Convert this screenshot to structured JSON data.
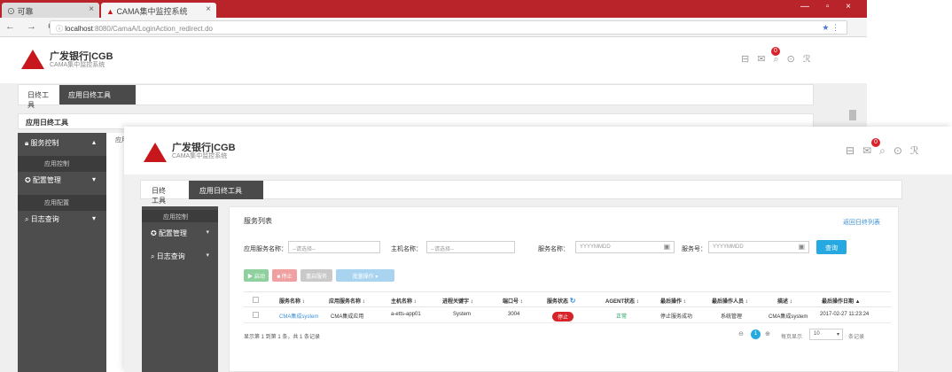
{
  "browser": {
    "tabs": [
      {
        "label": "⊙ 可靠",
        "close": "×"
      },
      {
        "label": "CAMA集中监控系统",
        "close": "×"
      }
    ],
    "window_controls": "— ▫ ×",
    "nav_buttons": "← → C",
    "url_host": "localhost",
    "url_rest": ":8080/CamaA/LoginAction_redirect.do",
    "url_icons": "★ ⋮"
  },
  "app": {
    "logo_main": "广发银行|CGB",
    "logo_sub": "CAMA集中监控系统",
    "notification_count": "0",
    "header_icons": [
      "grid-icon",
      "mail-icon",
      "search-icon",
      "help-icon",
      "user-icon"
    ],
    "brand_color": "#c8161d",
    "accent_color": "#25a9e0"
  },
  "back": {
    "tabs": [
      "日终工具",
      "应用日终工具"
    ],
    "section_title": "应用日终工具",
    "sidebar": [
      {
        "label": "服务控制",
        "sub": "应用控制"
      },
      {
        "label": "配置管理",
        "sub": "应用配置"
      },
      {
        "label": "日志查询",
        "sub": ""
      }
    ],
    "content_text": "应用"
  },
  "front": {
    "tabs": [
      "日终工具",
      "应用日终工具"
    ],
    "sidebar_sub": "应用控制",
    "sidebar": [
      {
        "label": "配置管理"
      },
      {
        "label": "日志查询"
      }
    ],
    "panel_title": "服务列表",
    "panel_link": "返回日终列表",
    "filters": [
      {
        "label": "应用服务名称：",
        "placeholder": "--请选择--"
      },
      {
        "label": "主机名称：",
        "placeholder": "--请选择--"
      },
      {
        "label": "服务名称：",
        "placeholder": "YYYYMMDD"
      },
      {
        "label": "服务号：",
        "placeholder": "YYYYMMDD"
      }
    ],
    "search_button": "查询",
    "tool_buttons": [
      "▶ 启动",
      "■ 停止",
      "重启服务",
      "批量操作 ▾"
    ],
    "table": {
      "headers": [
        "",
        "服务名称 ↕",
        "应用服务名称 ↕",
        "主机名称 ↕",
        "进程关键字 ↕",
        "端口号 ↕",
        "服务状态",
        "AGENT状态 ↕",
        "最后操作 ↕",
        "最后操作人员 ↕",
        "描述 ↕",
        "最后操作日期 ▲"
      ],
      "rows": [
        [
          "",
          "CMA集成system",
          "CMA集成应用",
          "a-etts-app01",
          "System",
          "3004",
          "停止",
          "正常",
          "停止服务成功",
          "系统管理",
          "CMA集成system",
          "2017-02-27 11:23:24"
        ]
      ]
    },
    "pager_text": "显示第 1 到第 1 条，共 1 条记录",
    "current_page": "1",
    "page_size_label": "每页显示",
    "page_size": "10",
    "page_size_suffix": "条记录"
  }
}
